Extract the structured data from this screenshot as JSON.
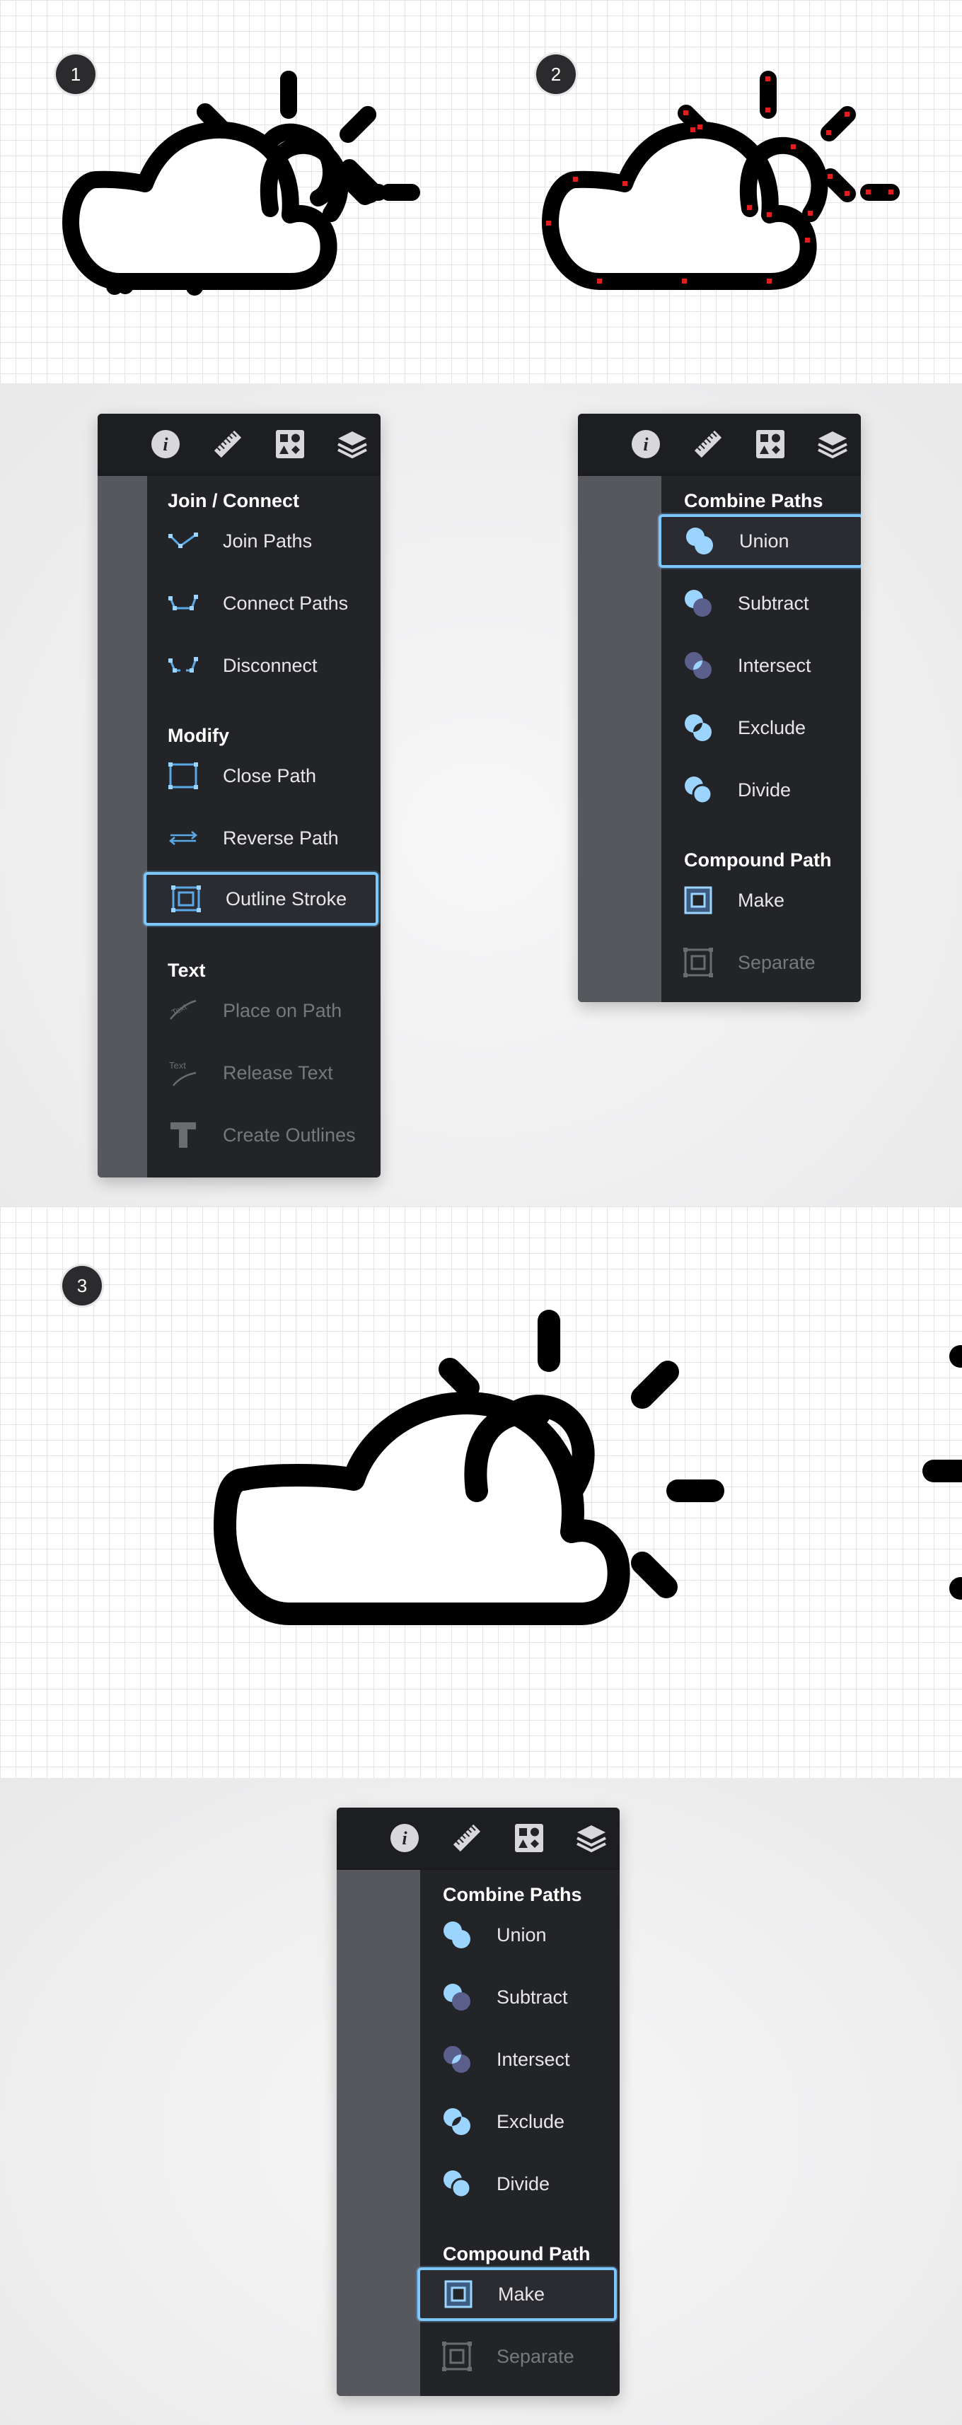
{
  "steps": [
    "1",
    "2",
    "3"
  ],
  "panel_a": {
    "sections": {
      "join": "Join / Connect",
      "modify": "Modify",
      "text": "Text"
    },
    "items": {
      "join_paths": "Join Paths",
      "connect_paths": "Connect Paths",
      "disconnect": "Disconnect",
      "close_path": "Close Path",
      "reverse_path": "Reverse Path",
      "outline_stroke": "Outline Stroke",
      "place_on_path": "Place on Path",
      "release_text": "Release Text",
      "create_outlines": "Create Outlines"
    },
    "selected": "Outline Stroke"
  },
  "panel_b": {
    "sections": {
      "combine": "Combine Paths",
      "compound": "Compound Path"
    },
    "items": {
      "union": "Union",
      "subtract": "Subtract",
      "intersect": "Intersect",
      "exclude": "Exclude",
      "divide": "Divide",
      "make": "Make",
      "separate": "Separate"
    },
    "selected": "Union"
  },
  "panel_c": {
    "sections": {
      "combine": "Combine Paths",
      "compound": "Compound Path"
    },
    "items": {
      "union": "Union",
      "subtract": "Subtract",
      "intersect": "Intersect",
      "exclude": "Exclude",
      "divide": "Divide",
      "make": "Make",
      "separate": "Separate"
    },
    "selected": "Make"
  },
  "toolbar_icons": [
    "info-icon",
    "ruler-icon",
    "shapes-icon",
    "layers-icon"
  ],
  "icon_names": [
    "cloud-sun-icon"
  ],
  "colors": {
    "panel_bg": "#232427",
    "rail": "#57585d",
    "selection": "#7cc7ff",
    "anchor_points": "#e02020",
    "artwork": "#000000"
  }
}
